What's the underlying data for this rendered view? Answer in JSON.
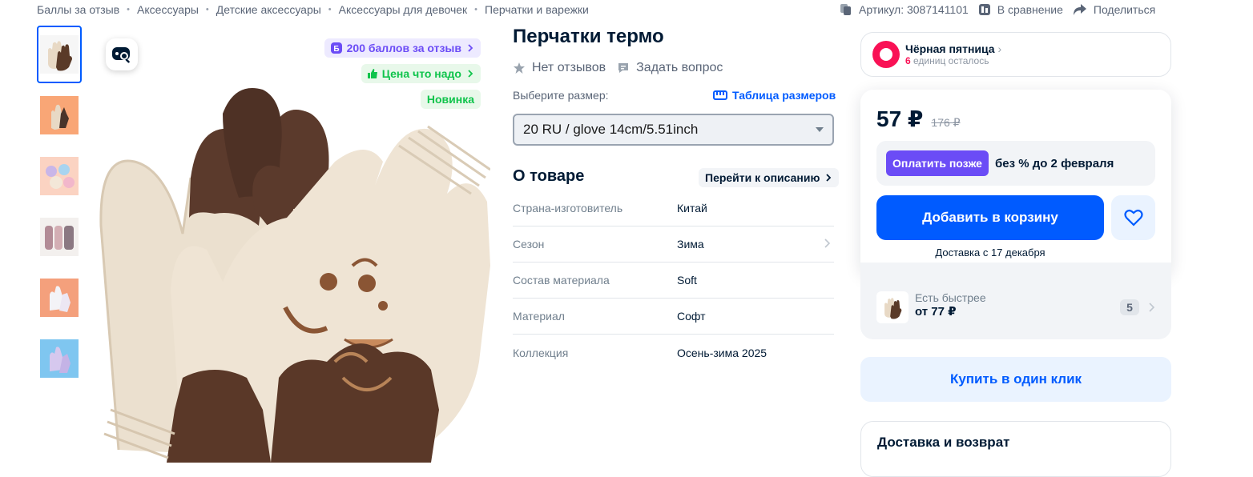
{
  "breadcrumbs": [
    "Баллы за отзыв",
    "Аксессуары",
    "Детские аксессуары",
    "Аксессуары для девочек",
    "Перчатки и варежки"
  ],
  "top_actions": {
    "article": "Артикул: 3087141101",
    "compare": "В сравнение",
    "share": "Поделиться"
  },
  "gallery": {
    "thumb_count": 6,
    "active_index": 0,
    "badges": {
      "points": "200 баллов за отзыв",
      "price": "Цена что надо",
      "new": "Новинка"
    }
  },
  "product": {
    "title": "Перчатки термо",
    "reviews": "Нет отзывов",
    "ask": "Задать вопрос",
    "size_label": "Выберите размер:",
    "size_table": "Таблица размеров",
    "size_value": "20 RU / glove 14cm/5.51inch"
  },
  "about": {
    "heading": "О товаре",
    "goto": "Перейти к описанию",
    "specs": [
      {
        "key": "Страна-изготовитель",
        "value": "Китай"
      },
      {
        "key": "Сезон",
        "value": "Зима"
      },
      {
        "key": "Состав материала",
        "value": "Soft"
      },
      {
        "key": "Материал",
        "value": "Софт"
      },
      {
        "key": "Коллекция",
        "value": "Осень-зима 2025"
      }
    ]
  },
  "promo": {
    "title": "Чёрная пятница",
    "count": "6",
    "left_text": " единиц осталось"
  },
  "buy": {
    "price": "57 ₽",
    "old_price": "176 ₽",
    "pay_later": "Оплатить позже",
    "pay_later_text": "без % до 2 февраля",
    "add_to_cart": "Добавить в корзину",
    "delivery": "Доставка с 17 декабря"
  },
  "faster": {
    "title": "Есть быстрее",
    "price": "от 77 ₽",
    "count": "5"
  },
  "one_click": "Купить в один клик",
  "delivery_return": "Доставка и возврат",
  "colors": {
    "accent": "#005bff",
    "points": "#6b4cf6",
    "green": "#10c44c",
    "promo": "#f91155"
  }
}
